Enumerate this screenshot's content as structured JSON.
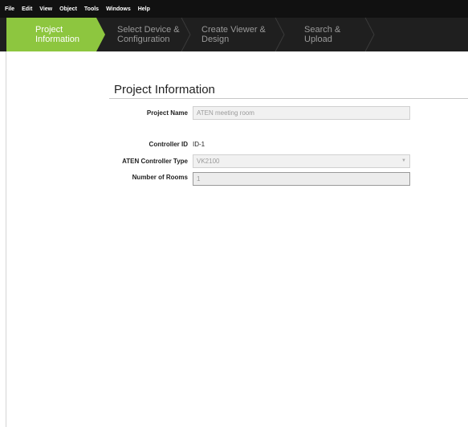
{
  "menu": [
    "File",
    "Edit",
    "View",
    "Object",
    "Tools",
    "Windows",
    "Help"
  ],
  "steps": [
    {
      "line1": "Project",
      "line2": "Information"
    },
    {
      "line1": "Select Device &",
      "line2": "Configuration"
    },
    {
      "line1": "Create Viewer &",
      "line2": "Design"
    },
    {
      "line1": "Search &",
      "line2": "Upload"
    }
  ],
  "colors": {
    "active_step": "#8dc63f",
    "menubar": "#111111",
    "stepbar": "#1f1f1f"
  },
  "section_title": "Project Information",
  "form": {
    "project_name_label": "Project Name",
    "project_name_value": "ATEN meeting room",
    "controller_id_label": "Controller ID",
    "controller_id_value": "ID-1",
    "controller_type_label": "ATEN Controller Type",
    "controller_type_value": "VK2100",
    "rooms_label": "Number of Rooms",
    "rooms_value": "1"
  }
}
